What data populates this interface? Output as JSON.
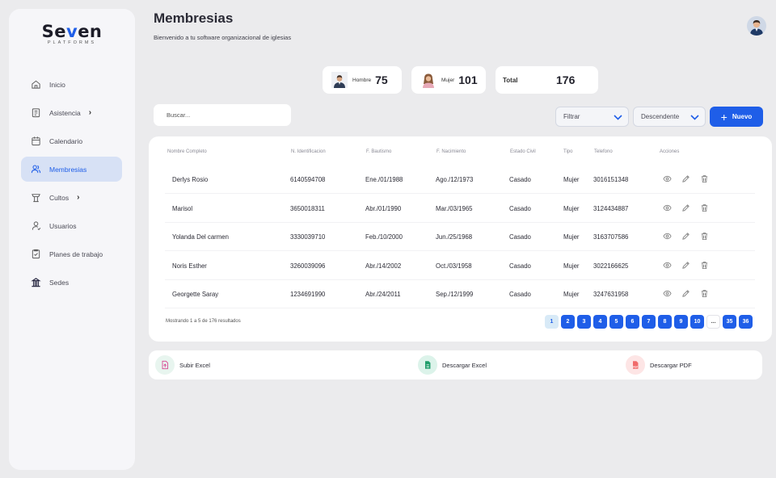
{
  "sidebar": {
    "logo_prefix": "Se",
    "logo_accent": "v",
    "logo_suffix": "en",
    "logo_sub": "PLATFORMS",
    "items": [
      {
        "label": "Inicio",
        "icon": "home-icon"
      },
      {
        "label": "Asistencia",
        "icon": "clipboard-icon",
        "chevron": "›"
      },
      {
        "label": "Calendario",
        "icon": "calendar-icon"
      },
      {
        "label": "Membresias",
        "icon": "users-icon"
      },
      {
        "label": "Cultos",
        "icon": "pulpit-icon",
        "chevron": "›"
      },
      {
        "label": "Usuarios",
        "icon": "user-icon"
      },
      {
        "label": "Planes de trabajo",
        "icon": "checklist-icon"
      },
      {
        "label": "Sedes",
        "icon": "building-icon"
      }
    ]
  },
  "header": {
    "title": "Membresias",
    "subtitle": "Bienvenido a tu software organizacional de iglesias"
  },
  "stats": {
    "male_label": "Hombre",
    "male_value": "75",
    "female_label": "Mujer",
    "female_value": "101",
    "total_label": "Total",
    "total_value": "176"
  },
  "toolbar": {
    "search_placeholder": "Buscar...",
    "filter_label": "Filtrar",
    "sort_label": "Descendente",
    "new_label": "Nuevo",
    "new_plus": "+"
  },
  "table": {
    "columns": [
      "Nombre Completo",
      "N. Identificacion",
      "F. Bautismo",
      "F. Nacimiento",
      "Estado Civil",
      "Tipo",
      "Telefono",
      "Acciones"
    ],
    "rows": [
      [
        "Derlys Rosio",
        "6140594708",
        "Ene./01/1988",
        "Ago./12/1973",
        "Casado",
        "Mujer",
        "3016151348"
      ],
      [
        "Marisol",
        "3650018311",
        "Abr./01/1990",
        "Mar./03/1965",
        "Casado",
        "Mujer",
        "3124434887"
      ],
      [
        "Yolanda Del carmen",
        "3330039710",
        "Feb./10/2000",
        "Jun./25/1968",
        "Casado",
        "Mujer",
        "3163707586"
      ],
      [
        "Noris Esther",
        "3260039096",
        "Abr./14/2002",
        "Oct./03/1958",
        "Casado",
        "Mujer",
        "3022166625"
      ],
      [
        "Georgette Saray",
        "1234691990",
        "Abr./24/2011",
        "Sep./12/1999",
        "Casado",
        "Mujer",
        "3247631958"
      ]
    ],
    "footer": "Mostrando 1 a 5 de 176 resultados",
    "pages": [
      "1",
      "2",
      "3",
      "4",
      "5",
      "6",
      "7",
      "8",
      "9",
      "10",
      "...",
      "35",
      "36"
    ]
  },
  "actions": {
    "upload_excel": "Subir Excel",
    "download_excel": "Descargar Excel",
    "download_pdf": "Descargar PDF",
    "pdf_tag": "PDF"
  },
  "colors": {
    "accent": "#1f5ee8",
    "active_nav_bg": "#d7e1f5",
    "upload_icon_bg": "#e8f5ef",
    "excel_icon_bg": "#dcf3ea",
    "pdf_icon_bg": "#fde5e5"
  }
}
